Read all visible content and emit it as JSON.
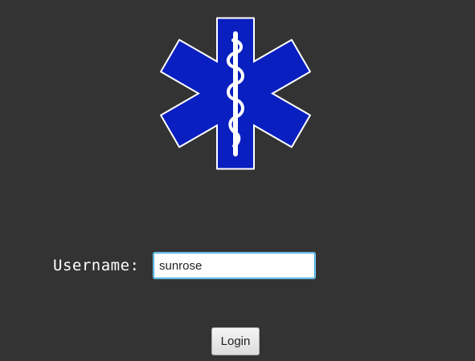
{
  "logo": {
    "icon": "star-of-life-icon",
    "colors": {
      "fill": "#0a1fbf",
      "outline": "#ffffff",
      "rod": "#ffffff"
    }
  },
  "login_form": {
    "username_label": "Username:",
    "username_value": "sunrose",
    "login_label": "Login"
  },
  "colors": {
    "background": "#333333",
    "input_focus_border": "#3aa3dc"
  }
}
